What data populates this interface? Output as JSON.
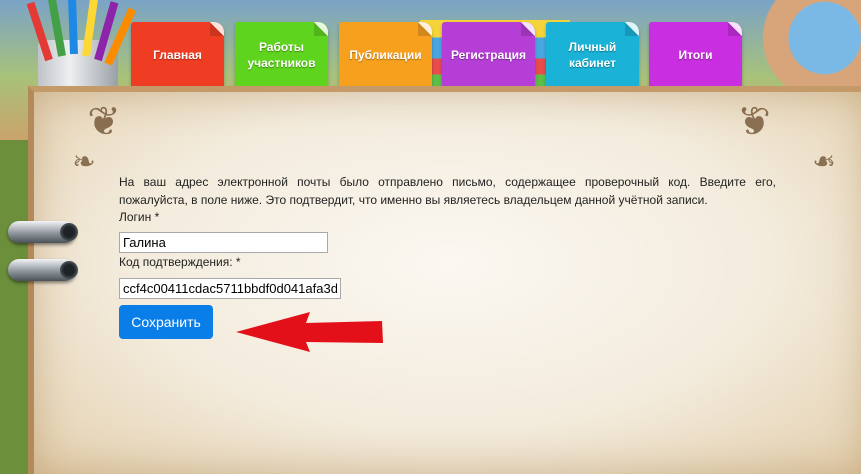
{
  "nav": {
    "tabs": [
      {
        "label": "Главная",
        "color": "#ee3d23"
      },
      {
        "label": "Работы участников",
        "color": "#5fd41e"
      },
      {
        "label": "Публикации",
        "color": "#f6a01e"
      },
      {
        "label": "Регистрация",
        "color": "#b53fd6"
      },
      {
        "label": "Личный кабинет",
        "color": "#1ab2d6"
      },
      {
        "label": "Итоги",
        "color": "#c92ee0"
      }
    ]
  },
  "confirm": {
    "message": "На ваш адрес электронной почты было отправлено письмо, содержащее проверочный код. Введите его, пожалуйста, в поле ниже. Это подтвердит, что именно вы являетесь владельцем данной учётной записи.",
    "login_label": "Логин *",
    "login_value": "Галина",
    "code_label": "Код подтверждения: *",
    "code_value": "ccf4c00411cdac5711bbdf0d041afa3d",
    "save_label": "Сохранить"
  },
  "colors": {
    "button": "#0a7ee8",
    "arrow": "#e3101a"
  },
  "icons": {
    "arrow": "red-left-arrow-icon",
    "ornaments": "corner-flourish-icon",
    "rings": "binder-ring-icon"
  }
}
